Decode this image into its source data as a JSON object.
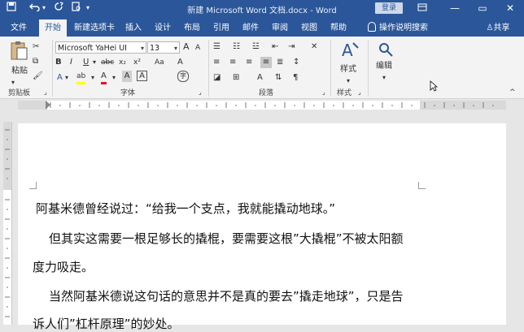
{
  "window": {
    "title": "新建 Microsoft Word 文档.docx - Word",
    "login_label": "登录",
    "minimize_icon": "—",
    "restore_icon": "▭",
    "close_icon": "✕"
  },
  "quick_access": {
    "save_icon": "save-icon",
    "undo_icon": "undo-icon",
    "redo_icon": "redo-icon",
    "more_icon": "▾"
  },
  "tabs": [
    "文件",
    "开始",
    "新建选项卡",
    "插入",
    "设计",
    "布局",
    "引用",
    "邮件",
    "审阅",
    "视图",
    "帮助"
  ],
  "active_tab": "开始",
  "tell_me": "操作说明搜索",
  "share": "共享",
  "ribbon": {
    "clipboard": {
      "paste_label": "粘贴",
      "group_label": "剪贴板"
    },
    "font": {
      "font_name": "Microsoft YaHei UI",
      "font_size": "13",
      "group_label": "字体",
      "bold": "B",
      "italic": "I",
      "underline": "U",
      "strike": "abc",
      "subscript": "x₂",
      "superscript": "x²",
      "grow": "A",
      "shrink": "A",
      "aa": "Aa",
      "clear": "A",
      "highlight": "ab",
      "font_color": "A",
      "char_shading": "A",
      "char_border": "A",
      "enclose": "字"
    },
    "paragraph": {
      "group_label": "段落"
    },
    "styles": {
      "label": "样式",
      "group_label": "样式"
    },
    "editing": {
      "label": "编辑"
    }
  },
  "document": {
    "paragraphs": [
      "阿基米德曾经说过：“给我一个支点，我就能撬动地球。”",
      "但其实这需要一根足够长的撬棍，要需要这根”大撬棍”不被太阳额",
      "度力吸走。",
      "当然阿基米德说这句话的意思并不是真的要去”撬走地球”，只是告",
      "诉人们”杠杆原理”的妙处。"
    ]
  },
  "colors": {
    "title_bar": "#2b579a",
    "ribbon": "#f3f3f3",
    "font_color_red": "#e81123",
    "highlight_yellow": "#ffff00"
  }
}
